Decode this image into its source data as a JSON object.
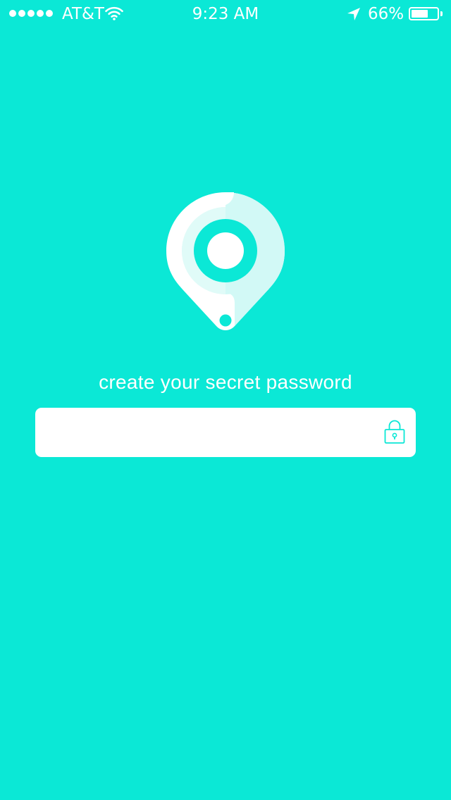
{
  "status_bar": {
    "carrier": "AT&T",
    "time": "9:23 AM",
    "battery_percent_text": "66%",
    "battery_level": 0.66,
    "signal_bars": 5,
    "icons": [
      "signal-dots-icon",
      "wifi-icon",
      "location-arrow-icon",
      "battery-icon"
    ]
  },
  "logo": {
    "icon": "location-pin-logo-icon"
  },
  "prompt": {
    "text": "create your secret password"
  },
  "password_field": {
    "value": "",
    "placeholder": "",
    "icon": "lock-icon"
  },
  "colors": {
    "background": "#0be8d6",
    "foreground": "#ffffff",
    "accent_light": "#d2f9f6"
  }
}
